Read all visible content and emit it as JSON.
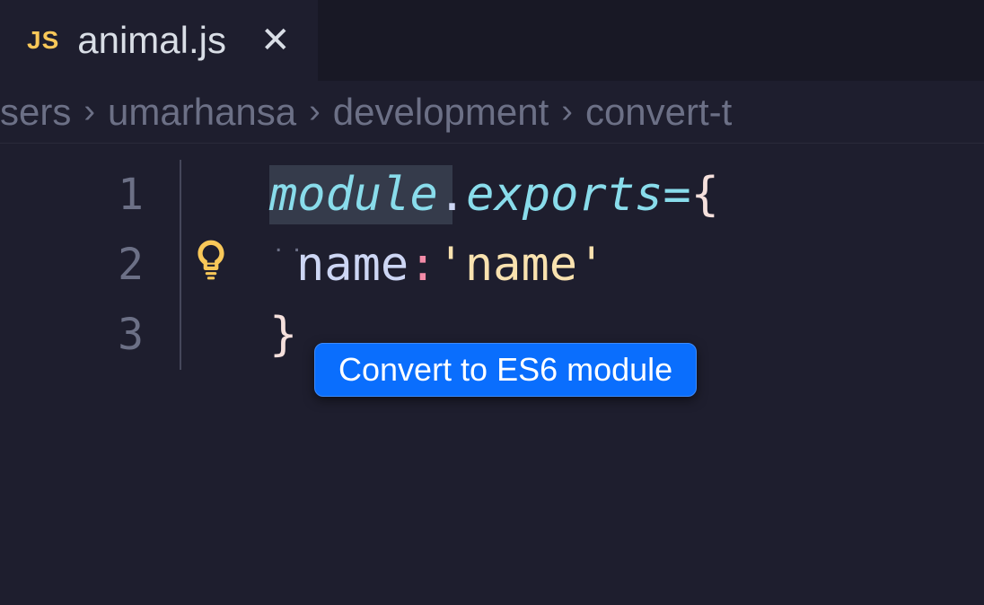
{
  "tab": {
    "icon_label": "JS",
    "filename": "animal.js"
  },
  "breadcrumb": {
    "parts": [
      "sers",
      "umarhansa",
      "development",
      "convert-t"
    ]
  },
  "editor": {
    "lines": [
      {
        "num": "1"
      },
      {
        "num": "2"
      },
      {
        "num": "3"
      }
    ],
    "tokens": {
      "module": "module",
      "dot": ".",
      "exports": "exports",
      "eq": " = ",
      "open_brace": "{",
      "indent_key": "name",
      "colon": ": ",
      "string": "'name'",
      "close_brace": "}"
    }
  },
  "quickfix": {
    "label": "Convert to ES6 module"
  }
}
